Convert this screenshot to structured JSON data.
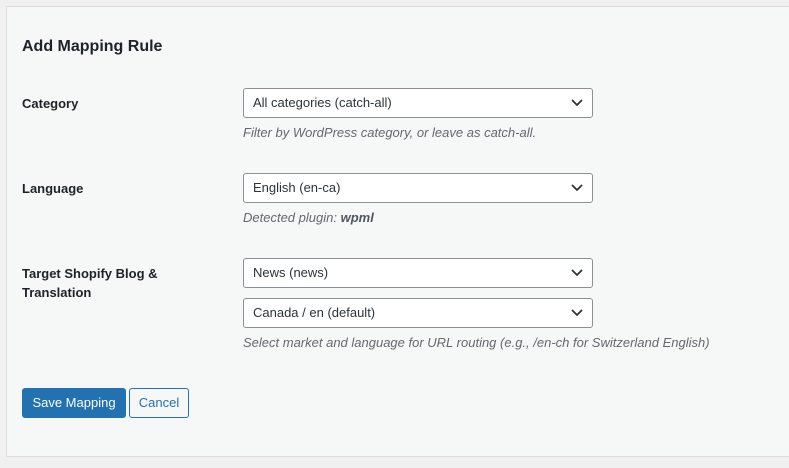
{
  "form": {
    "title": "Add Mapping Rule",
    "category": {
      "label": "Category",
      "selected": "All categories (catch-all)",
      "hint": "Filter by WordPress category, or leave as catch-all."
    },
    "language": {
      "label": "Language",
      "selected": "English (en-ca)",
      "hint_prefix": "Detected plugin: ",
      "hint_plugin": "wpml"
    },
    "target": {
      "label": "Target Shopify Blog & Translation",
      "blog_selected": "News (news)",
      "market_selected": "Canada / en (default)",
      "hint": "Select market and language for URL routing (e.g., /en-ch for Switzerland English)"
    },
    "buttons": {
      "save": "Save Mapping",
      "cancel": "Cancel"
    }
  },
  "icons": {
    "select_arrow": "chevron-down-icon"
  },
  "colors": {
    "primary": "#2271b1",
    "background": "#f0f0f1",
    "panel": "#f6f7f7",
    "hint_text": "#646970"
  }
}
